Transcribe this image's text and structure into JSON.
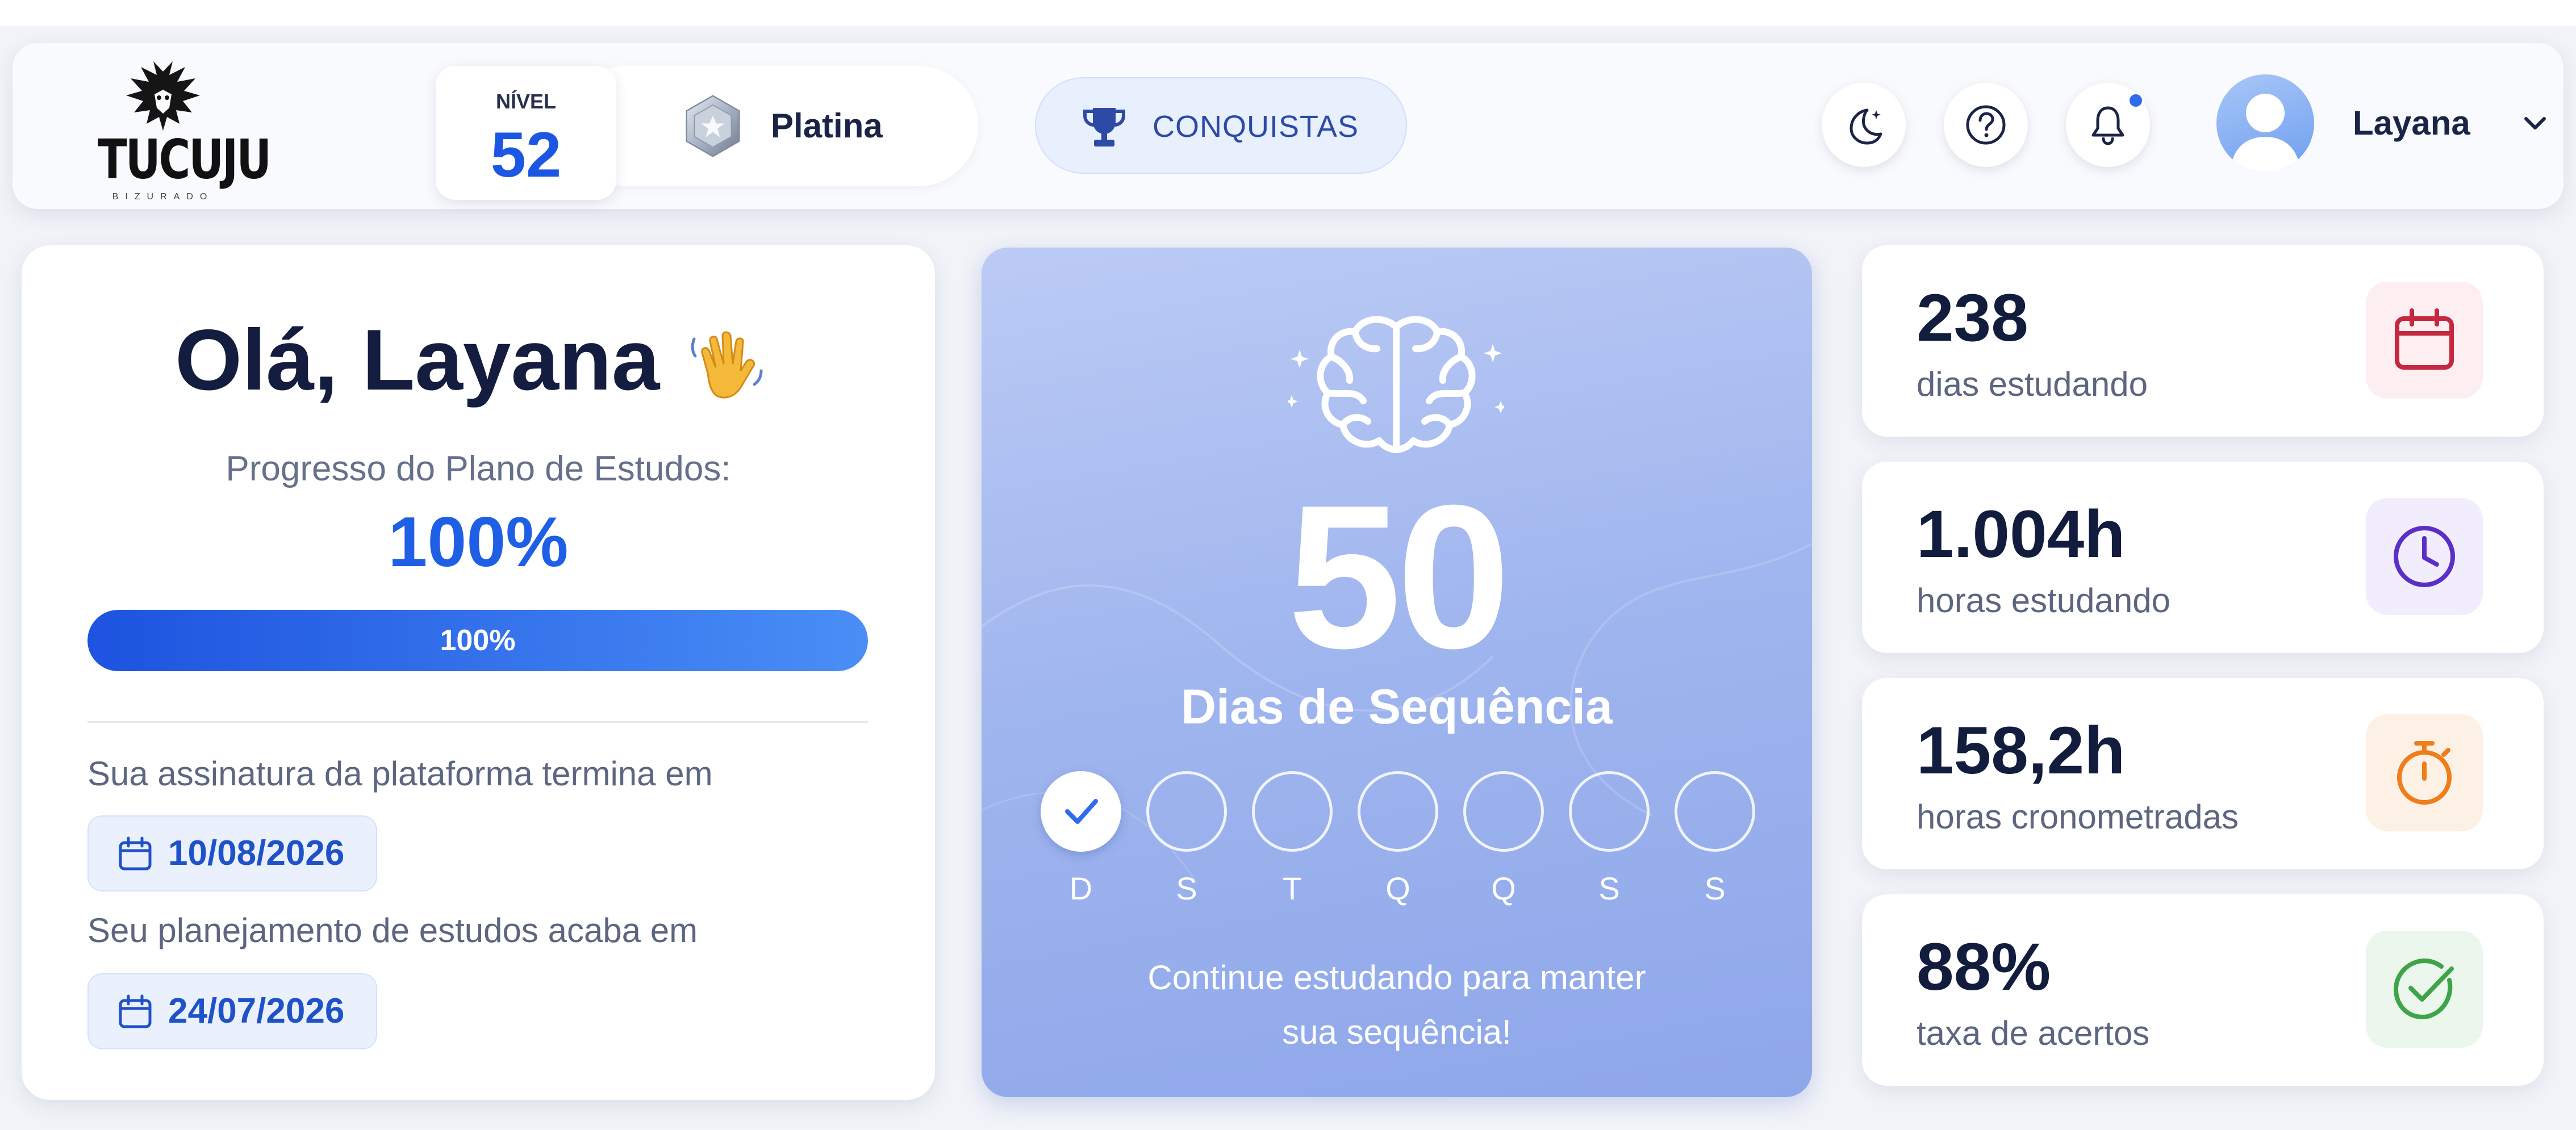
{
  "header": {
    "brand": {
      "name": "TUCUJU",
      "tagline": "BIZURADO"
    },
    "level": {
      "title": "NÍVEL",
      "value": "52"
    },
    "rank": {
      "label": "Platina"
    },
    "achievements_label": "CONQUISTAS",
    "icons": [
      "moon-icon",
      "help-icon",
      "bell-icon"
    ],
    "user": {
      "name": "Layana"
    }
  },
  "welcome": {
    "greeting": "Olá, Layana",
    "progress_label": "Progresso do Plano de Estudos:",
    "progress_value": "100%",
    "progress_fraction": 1.0,
    "progress_bar_label": "100%",
    "subscription_label": "Sua assinatura da plataforma termina em",
    "subscription_date": "10/08/2026",
    "plan_label": "Seu planejamento de estudos acaba em",
    "plan_date": "24/07/2026"
  },
  "streak": {
    "count": "50",
    "label": "Dias de Sequência",
    "days": [
      {
        "letter": "D",
        "done": true
      },
      {
        "letter": "S",
        "done": false
      },
      {
        "letter": "T",
        "done": false
      },
      {
        "letter": "Q",
        "done": false
      },
      {
        "letter": "Q",
        "done": false
      },
      {
        "letter": "S",
        "done": false
      },
      {
        "letter": "S",
        "done": false
      }
    ],
    "message_line1": "Continue estudando para manter",
    "message_line2": "sua sequência!"
  },
  "stats": [
    {
      "value": "238",
      "label": "dias estudando",
      "icon": "calendar-icon",
      "color": "#c4293f",
      "bg": "#fdeef1"
    },
    {
      "value": "1.004h",
      "label": "horas estudando",
      "icon": "clock-icon",
      "color": "#5b2fc7",
      "bg": "#f1edfd"
    },
    {
      "value": "158,2h",
      "label": "horas cronometradas",
      "icon": "stopwatch-icon",
      "color": "#ef7d1a",
      "bg": "#fdf1e6"
    },
    {
      "value": "88%",
      "label": "taxa de acertos",
      "icon": "check-circle-icon",
      "color": "#3fa34a",
      "bg": "#ebf6ec"
    }
  ],
  "colors": {
    "accent": "#1f5fe6",
    "streak_bg": "#9fb5ee",
    "page_bg": "#f1f3f8"
  }
}
